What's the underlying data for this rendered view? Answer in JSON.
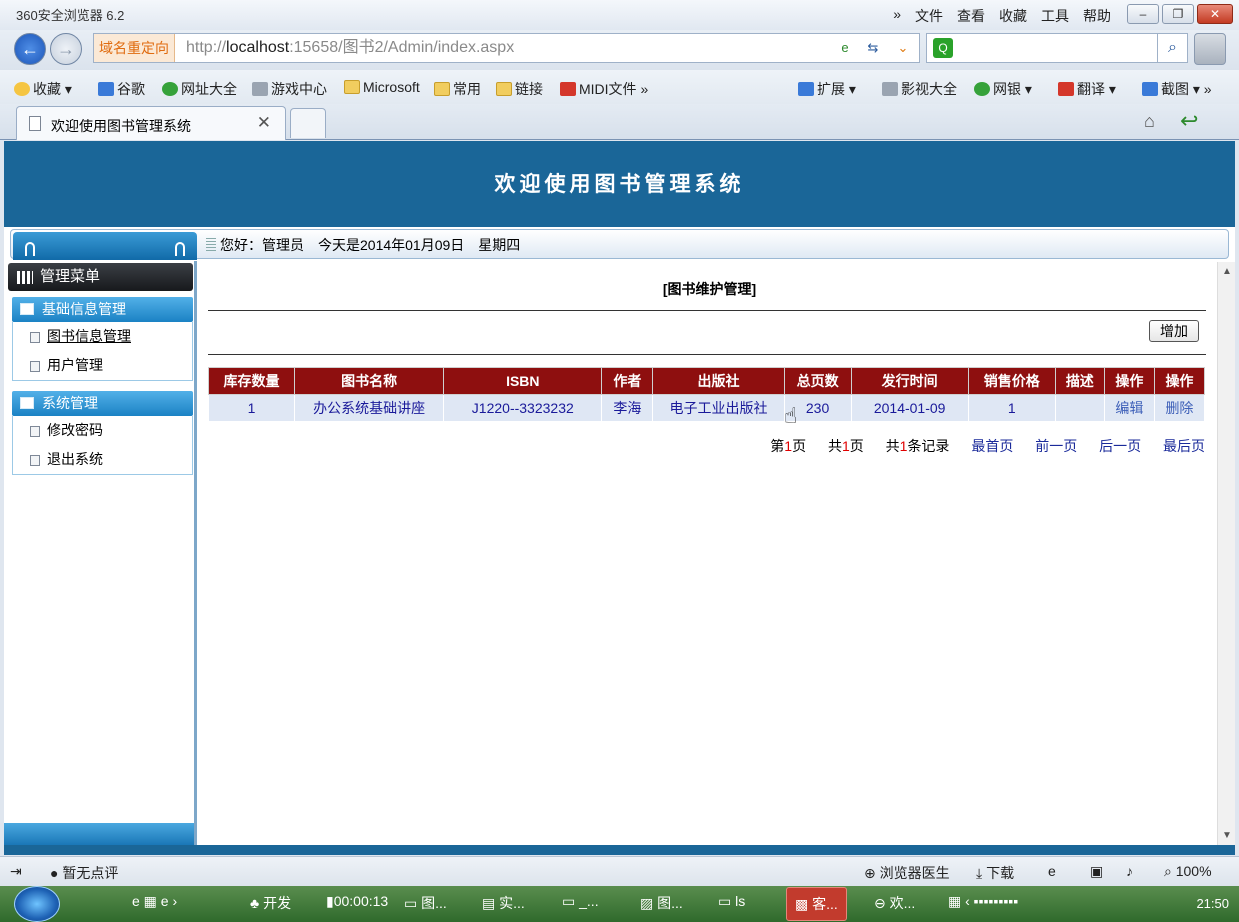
{
  "browser": {
    "title": "360安全浏览器 6.2",
    "menu": [
      "»",
      "文件",
      "查看",
      "收藏",
      "工具",
      "帮助"
    ],
    "url_tag": "域名重定向",
    "url_host": "localhost",
    "url_prefix": "http://",
    "url_rest": ":15658/图书2/Admin/index.aspx",
    "favorites": [
      "收藏",
      "谷歌",
      "网址大全",
      "游戏中心",
      "Microsoft",
      "常用",
      "链接",
      "MIDI文件"
    ],
    "favorites_right": [
      "扩展",
      "影视大全",
      "网银",
      "翻译",
      "截图"
    ],
    "tab_title": "欢迎使用图书管理系统"
  },
  "header": {
    "banner_title": "欢迎使用图书管理系统",
    "greeting": "您好：管理员",
    "date_text": "今天是2014年01月09日",
    "weekday": "星期四"
  },
  "sidebar": {
    "menu_title": "管理菜单",
    "groups": [
      {
        "title": "基础信息管理",
        "items": [
          "图书信息管理",
          "用户管理"
        ]
      },
      {
        "title": "系统管理",
        "items": [
          "修改密码",
          "退出系统"
        ]
      }
    ]
  },
  "main": {
    "title": "[图书维护管理]",
    "add_label": "增加",
    "columns": [
      "库存数量",
      "图书名称",
      "ISBN",
      "作者",
      "出版社",
      "总页数",
      "发行时间",
      "销售价格",
      "描述",
      "操作",
      "操作"
    ],
    "rows": [
      {
        "stock": "1",
        "name": "办公系统基础讲座",
        "isbn": "J1220--3323232",
        "author": "李海",
        "publisher": "电子工业出版社",
        "pages": "230",
        "date": "2014-01-09",
        "price": "1",
        "desc": "",
        "edit": "编辑",
        "delete": "删除"
      }
    ],
    "pager": {
      "page_prefix": "第",
      "page_num": "1",
      "page_suffix": "页",
      "total_prefix": "共",
      "total_num": "1",
      "total_suffix": "页",
      "records_prefix": "共",
      "records_num": "1",
      "records_suffix": "条记录",
      "first": "最首页",
      "prev": "前一页",
      "next": "后一页",
      "last": "最后页"
    }
  },
  "status": {
    "comment": "暂无点评",
    "doctor": "浏览器医生",
    "download": "下载",
    "zoom": "100%"
  },
  "taskbar": {
    "items": [
      "开发",
      "00:00:13",
      "图...",
      "实...",
      "_...",
      "图...",
      "ls",
      "客...",
      "欢..."
    ],
    "clock": "21:50"
  }
}
